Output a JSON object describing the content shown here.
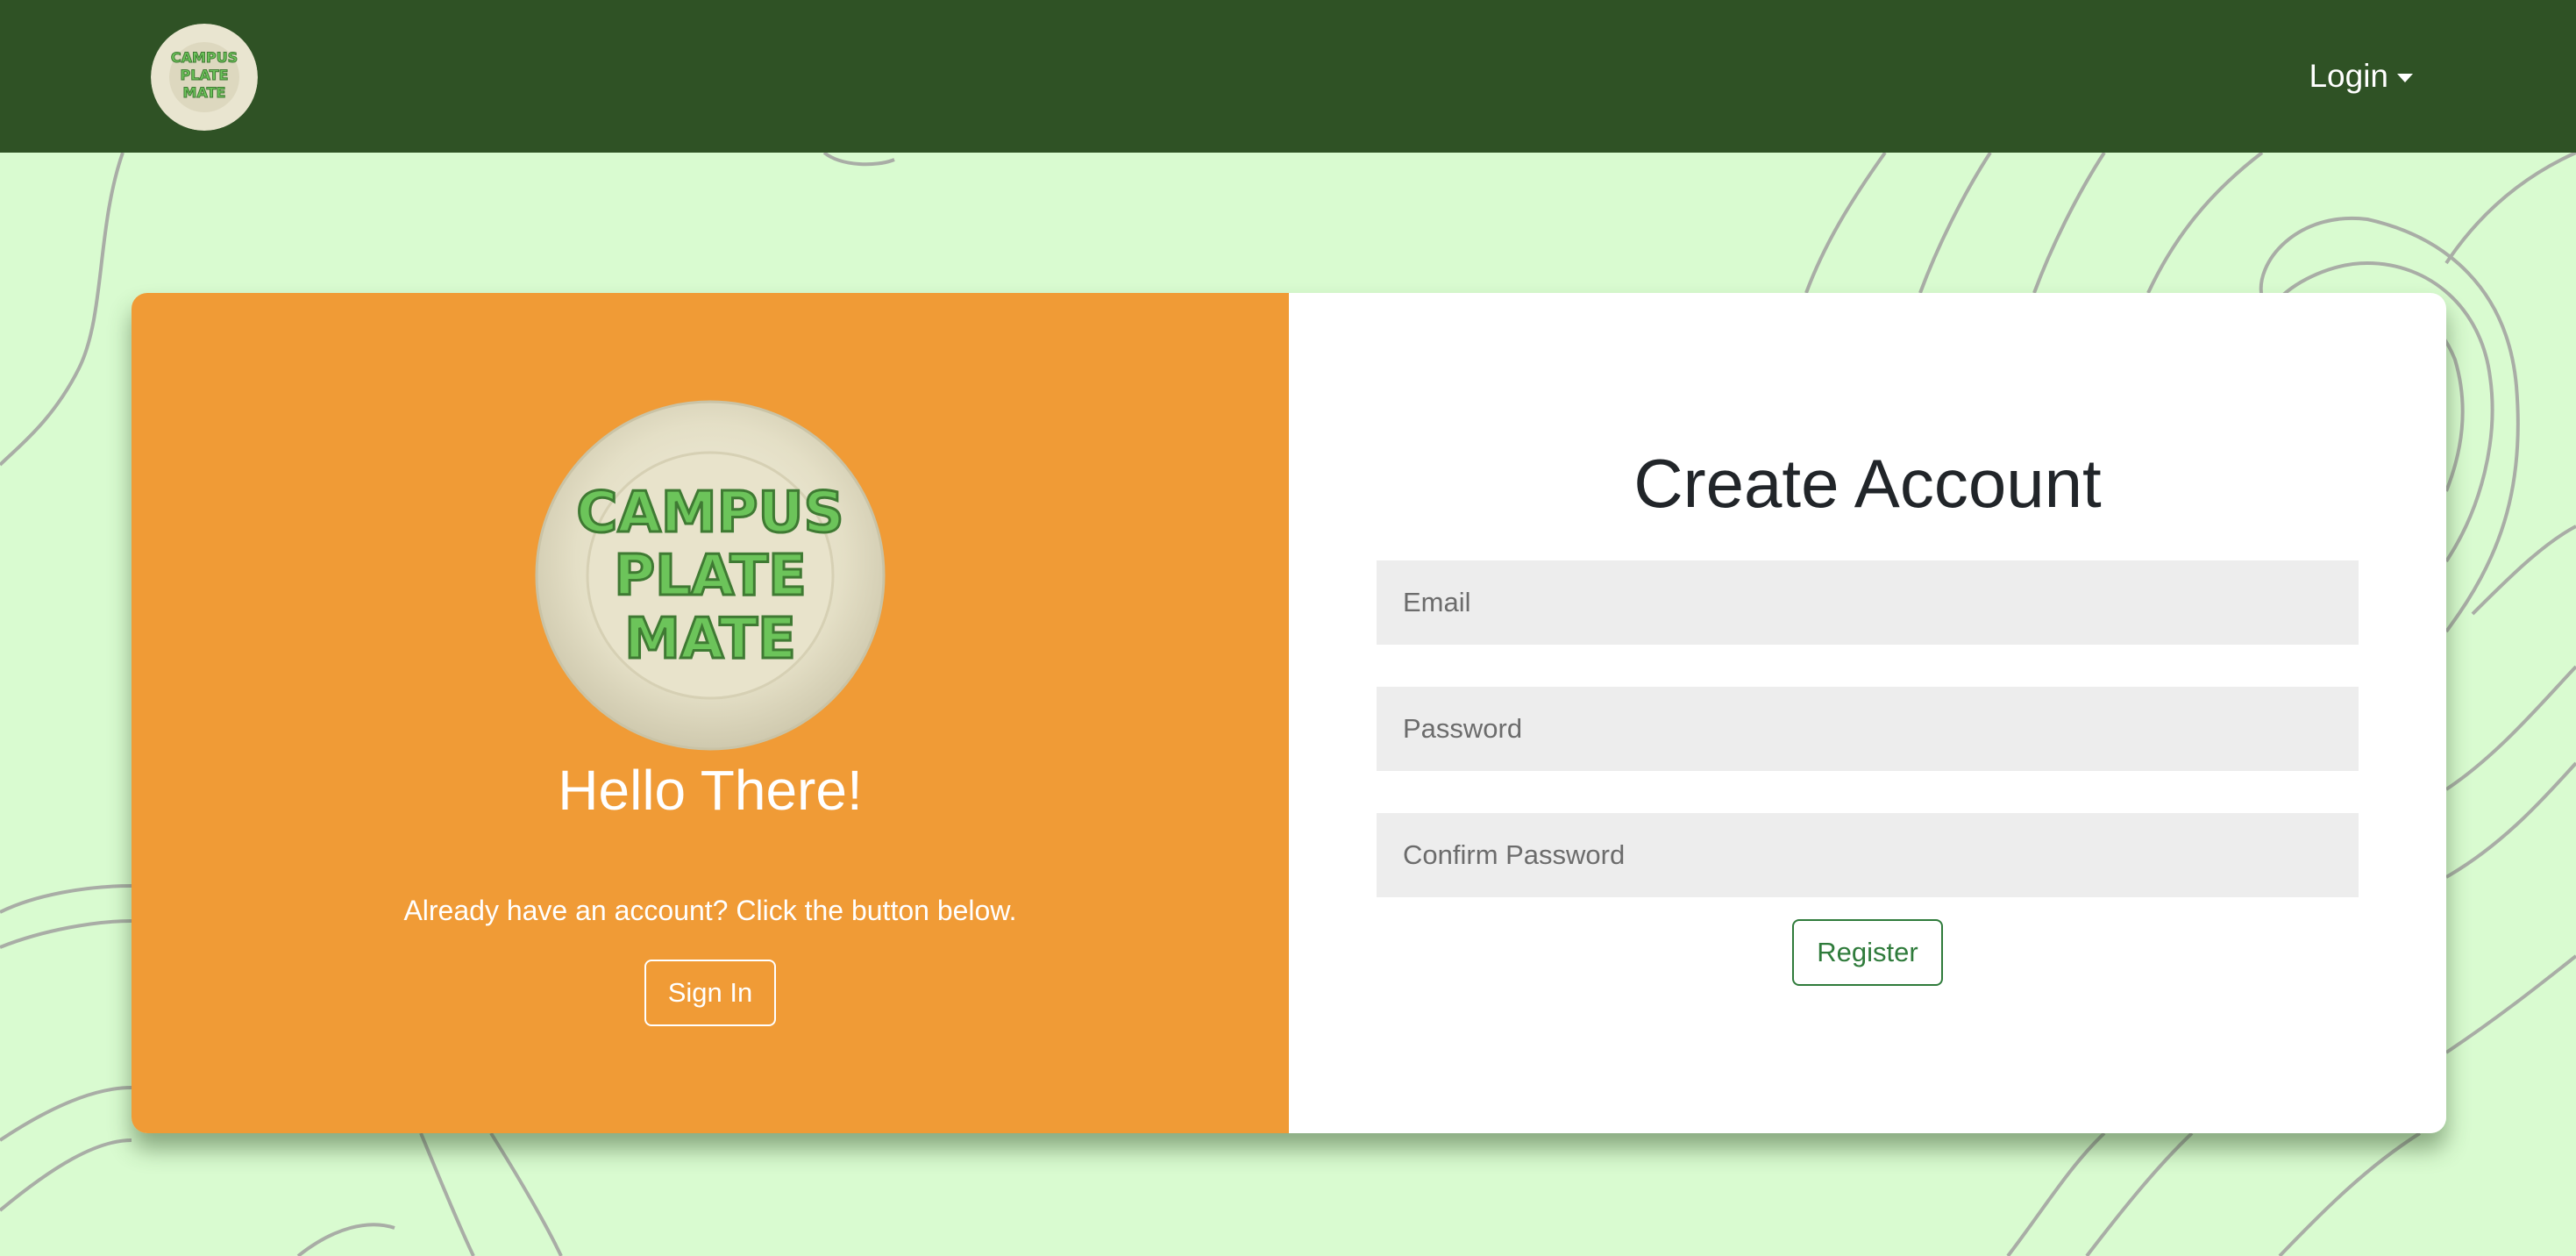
{
  "navbar": {
    "logo_text": "CAMPUS PLATE MATE",
    "login_label": "Login"
  },
  "left_panel": {
    "logo_text": "CAMPUS PLATE MATE",
    "heading": "Hello There!",
    "message": "Already have an account? Click the button below.",
    "signin_label": "Sign In"
  },
  "right_panel": {
    "title": "Create Account",
    "email_placeholder": "Email",
    "password_placeholder": "Password",
    "confirm_placeholder": "Confirm Password",
    "register_label": "Register"
  },
  "colors": {
    "navbar": "#2f5225",
    "page_background": "#d9fbd0",
    "left_panel": "#f09b36",
    "register_accent": "#2f7b3b",
    "logo_text": "#6cc45a"
  }
}
